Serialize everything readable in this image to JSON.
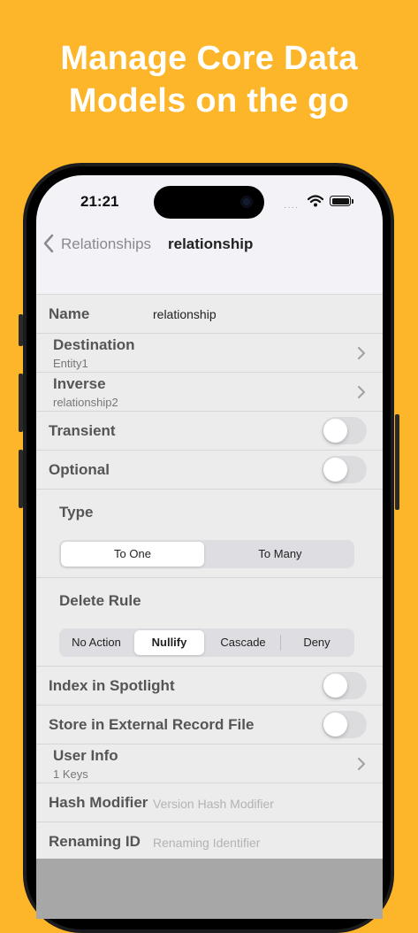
{
  "headline": {
    "line1": "Manage Core Data",
    "line2": "Models on the go"
  },
  "status": {
    "time": "21:21",
    "signal": "····"
  },
  "nav": {
    "back_label": "Relationships",
    "title": "relationship"
  },
  "fields": {
    "name": {
      "label": "Name",
      "value": "relationship"
    },
    "destination": {
      "label": "Destination",
      "value": "Entity1"
    },
    "inverse": {
      "label": "Inverse",
      "value": "relationship2"
    },
    "transient": {
      "label": "Transient",
      "on": false
    },
    "optional": {
      "label": "Optional",
      "on": false
    },
    "type": {
      "label": "Type",
      "options": [
        "To One",
        "To Many"
      ],
      "selected": "To One"
    },
    "delete_rule": {
      "label": "Delete Rule",
      "options": [
        "No Action",
        "Nullify",
        "Cascade",
        "Deny"
      ],
      "selected": "Nullify"
    },
    "index_spotlight": {
      "label": "Index in Spotlight",
      "on": false
    },
    "external_record": {
      "label": "Store in External Record File",
      "on": false
    },
    "user_info": {
      "label": "User Info",
      "value": "1 Keys"
    },
    "hash_modifier": {
      "label": "Hash Modifier",
      "placeholder": "Version Hash Modifier"
    },
    "renaming_id": {
      "label": "Renaming ID",
      "placeholder": "Renaming Identifier"
    }
  },
  "colors": {
    "background": "#FDB52A",
    "screen": "#F2F2F7",
    "list": "#ECECEC",
    "toggle_off": "#DCDCDF"
  }
}
